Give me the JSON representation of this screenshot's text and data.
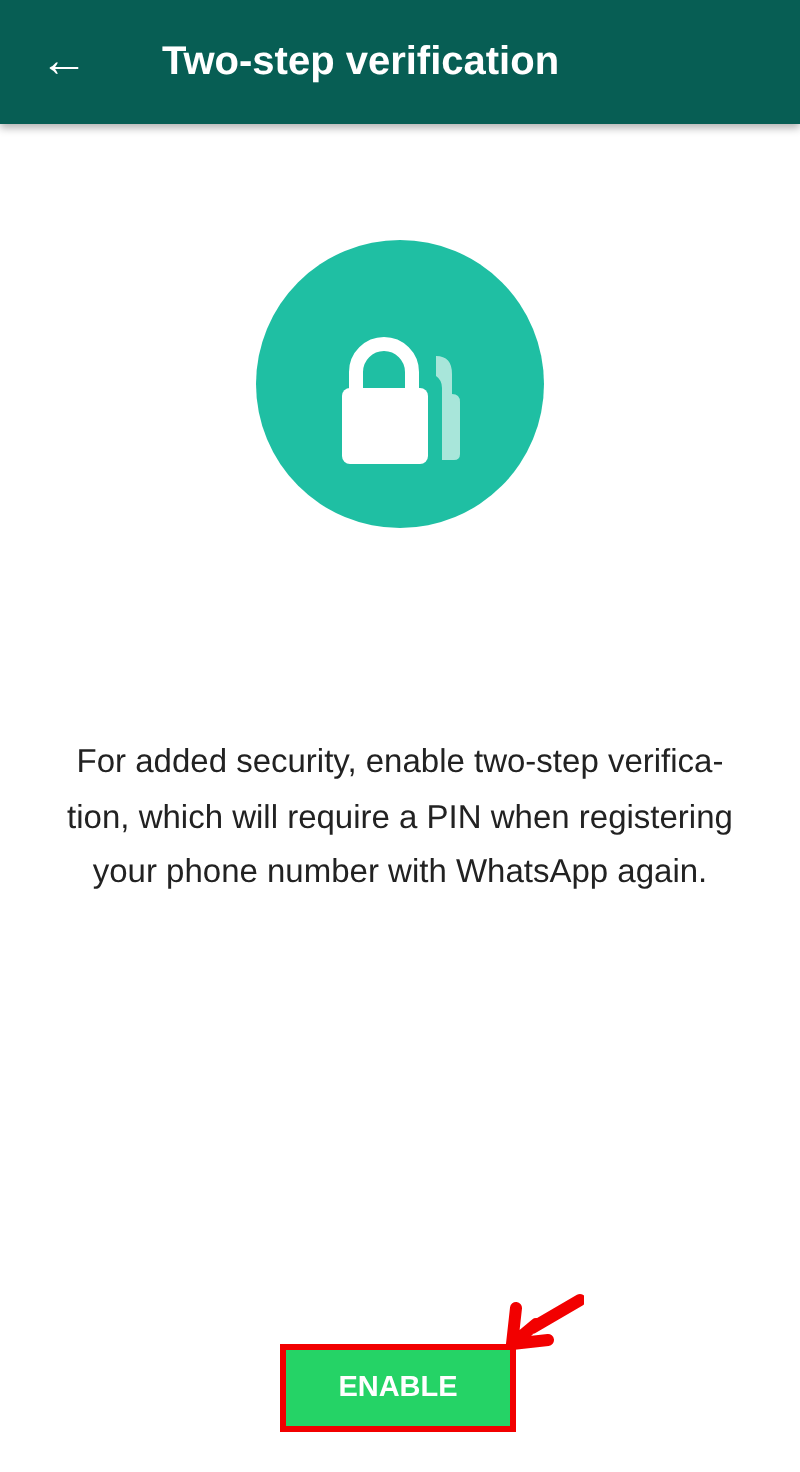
{
  "toolbar": {
    "back_icon": "←",
    "title": "Two-step verification"
  },
  "description": {
    "lines": [
      "For added security, enable two-step verifica-",
      "tion, which will require a PIN when registering",
      "your phone number with WhatsApp again."
    ]
  },
  "button": {
    "label": "ENABLE",
    "highlighted": true
  }
}
